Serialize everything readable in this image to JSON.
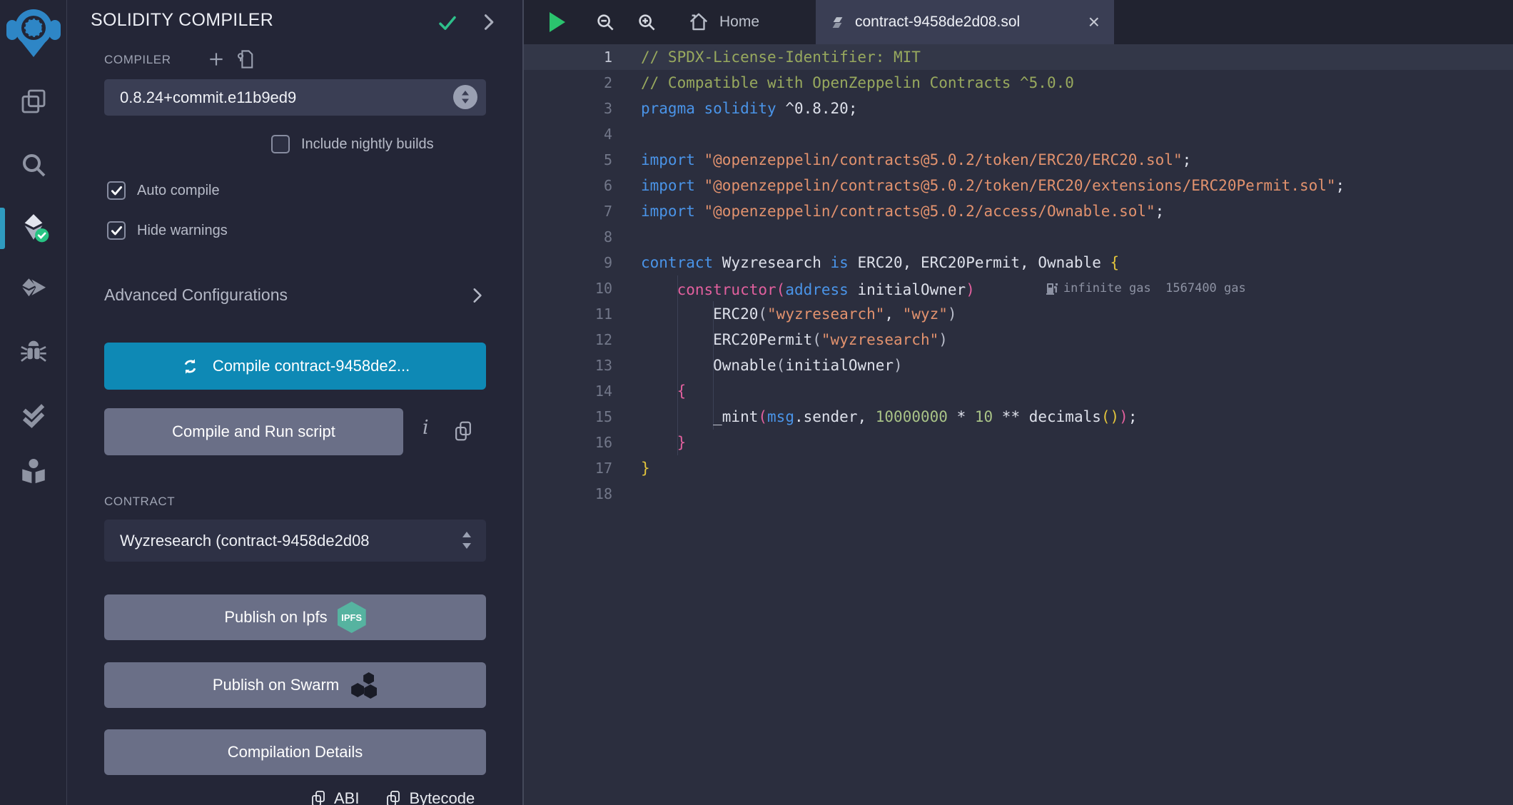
{
  "panel": {
    "title": "SOLIDITY COMPILER",
    "compiler_label": "COMPILER",
    "version_value": "0.8.24+commit.e11b9ed9",
    "nightly_label": "Include nightly builds",
    "nightly_checked": false,
    "auto_compile_label": "Auto compile",
    "auto_compile_checked": true,
    "hide_warnings_label": "Hide warnings",
    "hide_warnings_checked": true,
    "advanced_label": "Advanced Configurations",
    "compile_button_label": "Compile contract-9458de2...",
    "compile_run_button_label": "Compile and Run script",
    "info_glyph": "i",
    "contract_label": "CONTRACT",
    "contract_value": "Wyzresearch (contract-9458de2d08",
    "publish_ipfs_label": "Publish on Ipfs",
    "ipfs_badge": "IPFS",
    "publish_swarm_label": "Publish on Swarm",
    "compilation_details_label": "Compilation Details",
    "abi_label": "ABI",
    "bytecode_label": "Bytecode"
  },
  "rail": {
    "icons": [
      "remix-logo",
      "file-explorer-icon",
      "search-icon",
      "solidity-compiler-icon",
      "deploy-run-icon",
      "debugger-icon",
      "static-analysis-icon",
      "learn-icon"
    ],
    "active_item": "solidity-compiler"
  },
  "tabbar": {
    "home_label": "Home",
    "active_tab_label": "contract-9458de2d08.sol",
    "close_glyph": "×"
  },
  "editor": {
    "gas_annotation": "infinite gas  1567400 gas",
    "lines": [
      {
        "n": 1,
        "hl": true,
        "tokens": [
          [
            "c",
            "// SPDX-License-Identifier: MIT"
          ]
        ]
      },
      {
        "n": 2,
        "tokens": [
          [
            "c",
            "// Compatible with OpenZeppelin Contracts ^5.0.0"
          ]
        ]
      },
      {
        "n": 3,
        "tokens": [
          [
            "k",
            "pragma"
          ],
          [
            "t",
            " "
          ],
          [
            "k",
            "solidity"
          ],
          [
            "t",
            " ^0.8.20;"
          ]
        ]
      },
      {
        "n": 4,
        "tokens": []
      },
      {
        "n": 5,
        "tokens": [
          [
            "k",
            "import"
          ],
          [
            "t",
            " "
          ],
          [
            "s",
            "\"@openzeppelin/contracts@5.0.2/token/ERC20/ERC20.sol\""
          ],
          [
            "t",
            ";"
          ]
        ]
      },
      {
        "n": 6,
        "tokens": [
          [
            "k",
            "import"
          ],
          [
            "t",
            " "
          ],
          [
            "s",
            "\"@openzeppelin/contracts@5.0.2/token/ERC20/extensions/ERC20Permit.sol\""
          ],
          [
            "t",
            ";"
          ]
        ]
      },
      {
        "n": 7,
        "tokens": [
          [
            "k",
            "import"
          ],
          [
            "t",
            " "
          ],
          [
            "s",
            "\"@openzeppelin/contracts@5.0.2/access/Ownable.sol\""
          ],
          [
            "t",
            ";"
          ]
        ]
      },
      {
        "n": 8,
        "tokens": []
      },
      {
        "n": 9,
        "tokens": [
          [
            "k",
            "contract"
          ],
          [
            "t",
            " Wyzresearch "
          ],
          [
            "k",
            "is"
          ],
          [
            "t",
            " ERC20, ERC20Permit, Ownable "
          ],
          [
            "y",
            "{"
          ]
        ]
      },
      {
        "n": 10,
        "gas": true,
        "tokens": [
          [
            "t",
            "    "
          ],
          [
            "p",
            "constructor"
          ],
          [
            "p",
            "("
          ],
          [
            "k",
            "address"
          ],
          [
            "t",
            " initialOwner"
          ],
          [
            "p",
            ")"
          ]
        ]
      },
      {
        "n": 11,
        "tokens": [
          [
            "t",
            "        ERC20"
          ],
          [
            "d",
            "("
          ],
          [
            "s",
            "\"wyzresearch\""
          ],
          [
            "t",
            ", "
          ],
          [
            "s",
            "\"wyz\""
          ],
          [
            "d",
            ")"
          ]
        ]
      },
      {
        "n": 12,
        "tokens": [
          [
            "t",
            "        ERC20Permit"
          ],
          [
            "d",
            "("
          ],
          [
            "s",
            "\"wyzresearch\""
          ],
          [
            "d",
            ")"
          ]
        ]
      },
      {
        "n": 13,
        "tokens": [
          [
            "t",
            "        Ownable"
          ],
          [
            "d",
            "("
          ],
          [
            "t",
            "initialOwner"
          ],
          [
            "d",
            ")"
          ]
        ]
      },
      {
        "n": 14,
        "tokens": [
          [
            "t",
            "    "
          ],
          [
            "p",
            "{"
          ]
        ]
      },
      {
        "n": 15,
        "tokens": [
          [
            "t",
            "        _mint"
          ],
          [
            "p",
            "("
          ],
          [
            "k",
            "msg"
          ],
          [
            "t",
            ".sender, "
          ],
          [
            "n",
            "10000000"
          ],
          [
            "t",
            " * "
          ],
          [
            "n",
            "10"
          ],
          [
            "t",
            " ** decimals"
          ],
          [
            "y",
            "()"
          ],
          [
            "p",
            ")"
          ],
          [
            "t",
            ";"
          ]
        ]
      },
      {
        "n": 16,
        "tokens": [
          [
            "t",
            "    "
          ],
          [
            "p",
            "}"
          ]
        ]
      },
      {
        "n": 17,
        "tokens": [
          [
            "y",
            "}"
          ]
        ]
      },
      {
        "n": 18,
        "tokens": []
      }
    ]
  },
  "colors": {
    "primary_button": "#0e89b5",
    "secondary_button": "#6a6f87",
    "success_check": "#2ec08b",
    "compiler_badge": "#27c383",
    "play_button": "#2bc36e",
    "active_indicator": "#2f9bbf",
    "ipfs_badge_bg": "#56b3a0",
    "editor_bg": "#2b2e3e",
    "panel_bg": "#242637"
  }
}
